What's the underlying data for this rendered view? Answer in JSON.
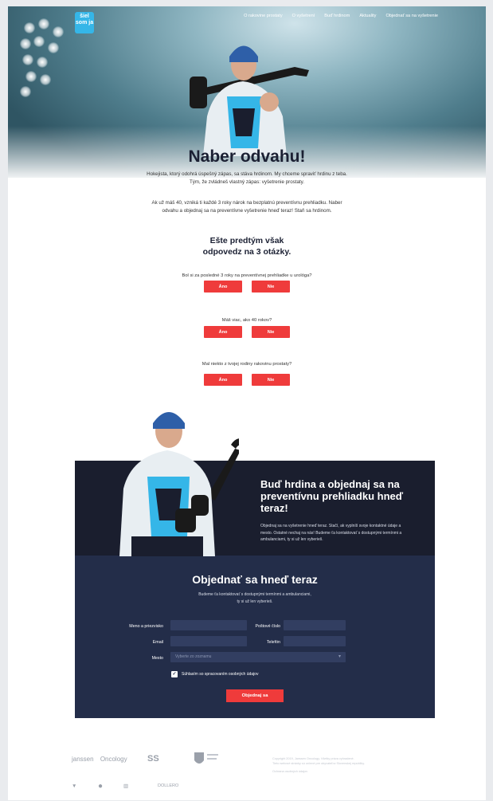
{
  "logo": {
    "text": "šiel som ja"
  },
  "nav": {
    "items": [
      "O rakovine prostaty",
      "O vyšetrení",
      "Buď hrdinom",
      "Aktuality",
      "Objednať sa na vyšetrenie"
    ]
  },
  "hero": {
    "headline": "Naber odvahu!",
    "intro": "Hokejista, ktorý odohrá úspešný zápas, sa stáva hrdinom. My chceme spraviť hrdinu z teba. Tým, že zvládneš vlastný zápas: vyšetrenie prostaty.",
    "intro2": "Ak už máš 40, vzniká ti každé 3 roky nárok na bezplatnú preventívnu prehliadku. Naber odvahu a objednaj sa na preventívne vyšetrenie hneď teraz! Staň sa hrdinom."
  },
  "quiz": {
    "title_line1": "Ešte predtým však",
    "title_line2": "odpovedz na 3 otázky.",
    "questions": [
      {
        "text": "Bol si za posledné 3 roky na preventívnej prehliadke u urológa?",
        "yes": "Áno",
        "no": "Nie"
      },
      {
        "text": "Máš viac, ako 40 rokov?",
        "yes": "Áno",
        "no": "Nie"
      },
      {
        "text": "Mal niekto z tvojej rodiny rakovinu prostaty?",
        "yes": "Áno",
        "no": "Nie"
      }
    ]
  },
  "cta": {
    "title": "Buď hrdina a objednaj sa na preventívnu prehliadku hneď teraz!",
    "text": "Objednaj sa na vyšetrenie hneď teraz. Stačí, ak vyplníš svoje kontaktné údaje a mesto. Ostatné nechaj na nás! Budeme ťa kontaktovať s dostupnými termínmi a ambulanciami, ty si už len vyberieš."
  },
  "form": {
    "title": "Objednať sa hneď teraz",
    "subtitle_line1": "Budeme ťa kontaktovať s dostupnými termínmi a ambulanciami,",
    "subtitle_line2": "ty si už len vyberieš.",
    "labels": {
      "name": "Meno a priezvisko",
      "zip": "Poštové číslo",
      "email": "Email",
      "phone": "Telefón",
      "city": "Mesto"
    },
    "city_placeholder": "Vyberte zo zoznamu",
    "consent": "Súhlasím so spracovaním osobných údajov",
    "submit": "Objednaj sa"
  },
  "footer": {
    "logos": [
      "janssen",
      "Oncology",
      "SS",
      "DOLLERO"
    ],
    "text_line1": "Copyright 2019, Janssen Oncology. Všetky práva vyhradené.",
    "text_line2": "Tieto webové stránky sú určené pre obyvateľov Slovenskej republiky.",
    "text_line3": "Ochrana osobných údajov"
  },
  "colors": {
    "accent": "#ef3b3b",
    "navy": "#1a1e2e",
    "form_bg": "#232d49"
  }
}
